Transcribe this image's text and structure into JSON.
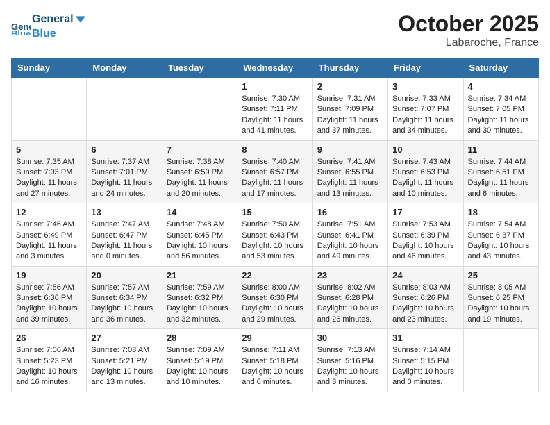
{
  "header": {
    "logo_general": "General",
    "logo_blue": "Blue",
    "month": "October 2025",
    "location": "Labaroche, France"
  },
  "weekdays": [
    "Sunday",
    "Monday",
    "Tuesday",
    "Wednesday",
    "Thursday",
    "Friday",
    "Saturday"
  ],
  "weeks": [
    [
      {
        "day": "",
        "info": ""
      },
      {
        "day": "",
        "info": ""
      },
      {
        "day": "",
        "info": ""
      },
      {
        "day": "1",
        "info": "Sunrise: 7:30 AM\nSunset: 7:11 PM\nDaylight: 11 hours\nand 41 minutes."
      },
      {
        "day": "2",
        "info": "Sunrise: 7:31 AM\nSunset: 7:09 PM\nDaylight: 11 hours\nand 37 minutes."
      },
      {
        "day": "3",
        "info": "Sunrise: 7:33 AM\nSunset: 7:07 PM\nDaylight: 11 hours\nand 34 minutes."
      },
      {
        "day": "4",
        "info": "Sunrise: 7:34 AM\nSunset: 7:05 PM\nDaylight: 11 hours\nand 30 minutes."
      }
    ],
    [
      {
        "day": "5",
        "info": "Sunrise: 7:35 AM\nSunset: 7:03 PM\nDaylight: 11 hours\nand 27 minutes."
      },
      {
        "day": "6",
        "info": "Sunrise: 7:37 AM\nSunset: 7:01 PM\nDaylight: 11 hours\nand 24 minutes."
      },
      {
        "day": "7",
        "info": "Sunrise: 7:38 AM\nSunset: 6:59 PM\nDaylight: 11 hours\nand 20 minutes."
      },
      {
        "day": "8",
        "info": "Sunrise: 7:40 AM\nSunset: 6:57 PM\nDaylight: 11 hours\nand 17 minutes."
      },
      {
        "day": "9",
        "info": "Sunrise: 7:41 AM\nSunset: 6:55 PM\nDaylight: 11 hours\nand 13 minutes."
      },
      {
        "day": "10",
        "info": "Sunrise: 7:43 AM\nSunset: 6:53 PM\nDaylight: 11 hours\nand 10 minutes."
      },
      {
        "day": "11",
        "info": "Sunrise: 7:44 AM\nSunset: 6:51 PM\nDaylight: 11 hours\nand 6 minutes."
      }
    ],
    [
      {
        "day": "12",
        "info": "Sunrise: 7:46 AM\nSunset: 6:49 PM\nDaylight: 11 hours\nand 3 minutes."
      },
      {
        "day": "13",
        "info": "Sunrise: 7:47 AM\nSunset: 6:47 PM\nDaylight: 11 hours\nand 0 minutes."
      },
      {
        "day": "14",
        "info": "Sunrise: 7:48 AM\nSunset: 6:45 PM\nDaylight: 10 hours\nand 56 minutes."
      },
      {
        "day": "15",
        "info": "Sunrise: 7:50 AM\nSunset: 6:43 PM\nDaylight: 10 hours\nand 53 minutes."
      },
      {
        "day": "16",
        "info": "Sunrise: 7:51 AM\nSunset: 6:41 PM\nDaylight: 10 hours\nand 49 minutes."
      },
      {
        "day": "17",
        "info": "Sunrise: 7:53 AM\nSunset: 6:39 PM\nDaylight: 10 hours\nand 46 minutes."
      },
      {
        "day": "18",
        "info": "Sunrise: 7:54 AM\nSunset: 6:37 PM\nDaylight: 10 hours\nand 43 minutes."
      }
    ],
    [
      {
        "day": "19",
        "info": "Sunrise: 7:56 AM\nSunset: 6:36 PM\nDaylight: 10 hours\nand 39 minutes."
      },
      {
        "day": "20",
        "info": "Sunrise: 7:57 AM\nSunset: 6:34 PM\nDaylight: 10 hours\nand 36 minutes."
      },
      {
        "day": "21",
        "info": "Sunrise: 7:59 AM\nSunset: 6:32 PM\nDaylight: 10 hours\nand 32 minutes."
      },
      {
        "day": "22",
        "info": "Sunrise: 8:00 AM\nSunset: 6:30 PM\nDaylight: 10 hours\nand 29 minutes."
      },
      {
        "day": "23",
        "info": "Sunrise: 8:02 AM\nSunset: 6:28 PM\nDaylight: 10 hours\nand 26 minutes."
      },
      {
        "day": "24",
        "info": "Sunrise: 8:03 AM\nSunset: 6:26 PM\nDaylight: 10 hours\nand 23 minutes."
      },
      {
        "day": "25",
        "info": "Sunrise: 8:05 AM\nSunset: 6:25 PM\nDaylight: 10 hours\nand 19 minutes."
      }
    ],
    [
      {
        "day": "26",
        "info": "Sunrise: 7:06 AM\nSunset: 5:23 PM\nDaylight: 10 hours\nand 16 minutes."
      },
      {
        "day": "27",
        "info": "Sunrise: 7:08 AM\nSunset: 5:21 PM\nDaylight: 10 hours\nand 13 minutes."
      },
      {
        "day": "28",
        "info": "Sunrise: 7:09 AM\nSunset: 5:19 PM\nDaylight: 10 hours\nand 10 minutes."
      },
      {
        "day": "29",
        "info": "Sunrise: 7:11 AM\nSunset: 5:18 PM\nDaylight: 10 hours\nand 6 minutes."
      },
      {
        "day": "30",
        "info": "Sunrise: 7:13 AM\nSunset: 5:16 PM\nDaylight: 10 hours\nand 3 minutes."
      },
      {
        "day": "31",
        "info": "Sunrise: 7:14 AM\nSunset: 5:15 PM\nDaylight: 10 hours\nand 0 minutes."
      },
      {
        "day": "",
        "info": ""
      }
    ]
  ]
}
